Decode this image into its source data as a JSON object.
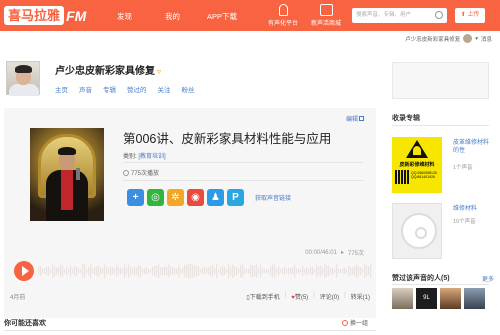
{
  "header": {
    "logo_text": "喜马拉雅",
    "logo_fm": "FM",
    "nav": [
      "发现",
      "我的",
      "APP下载"
    ],
    "icons": [
      {
        "label": "有声化平台",
        "icon": "microphone-icon"
      },
      {
        "label": "新声活商城",
        "icon": "store-icon"
      }
    ],
    "search_placeholder": "搜索声音、专辑、用户",
    "upload_label": "上传"
  },
  "userbar": {
    "username": "卢少忠皮新彩家具修复",
    "messages_label": "消息"
  },
  "profile": {
    "name": "卢少忠皮新彩家具修复",
    "tabs": [
      "主页",
      "声音",
      "专辑",
      "赞过的",
      "关注",
      "粉丝"
    ]
  },
  "track": {
    "edit_label": "编辑",
    "title": "第006讲、皮新彩家具材料性能与应用",
    "category_label": "类别:",
    "category": "[教育培训]",
    "play_count": "775次播放",
    "share_link": "获取声音链接",
    "time": "00:00/46:01",
    "plays_short": "775次",
    "age": "4月前",
    "actions": {
      "download": "下载到手机",
      "like": "赞(5)",
      "comment": "评论(0)",
      "forward": "转采(1)"
    },
    "waveform": {
      "color": "#e9e4e1",
      "progress_color": "#f86442",
      "progress": 0
    }
  },
  "guess": {
    "title": "你可能还喜欢",
    "refresh_label": "换一组"
  },
  "sidebar": {
    "albums_title": "收录专辑",
    "albums": [
      {
        "name": "皮革维修材料的性",
        "count": "1个声音",
        "cover_title": "皮新彩修维材料",
        "cover_text": "QQ:2660598126 QQ:861401926"
      },
      {
        "name": "维修材料",
        "count": "10个声音"
      }
    ],
    "likers_title": "赞过该声音的人(5)",
    "more_label": "更多",
    "liker_badge": "9L"
  },
  "colors": {
    "brand": "#f86442",
    "link": "#4a7cc4"
  }
}
